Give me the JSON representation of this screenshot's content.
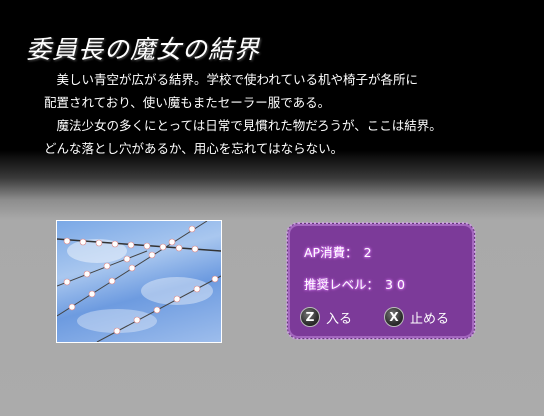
{
  "title": "委員長の魔女の結界",
  "description": [
    "　美しい青空が広がる結界。学校で使われている机や椅子が各所に",
    "配置されており、使い魔もまたセーラー服である。",
    "　魔法少女の多くにとっては日常で見慣れた物だろうが、ここは結界。",
    "どんな落とし穴があるか、用心を忘れてはならない。"
  ],
  "stats": {
    "ap_label": "AP消費：",
    "ap_value": "2",
    "level_label": "推奨レベル：",
    "level_value": "30"
  },
  "buttons": {
    "enter": {
      "key": "Z",
      "label": "入る"
    },
    "stop": {
      "key": "X",
      "label": "止める"
    }
  },
  "colors": {
    "panel": "#7c3a99",
    "stat_glow": "#e07cff"
  }
}
